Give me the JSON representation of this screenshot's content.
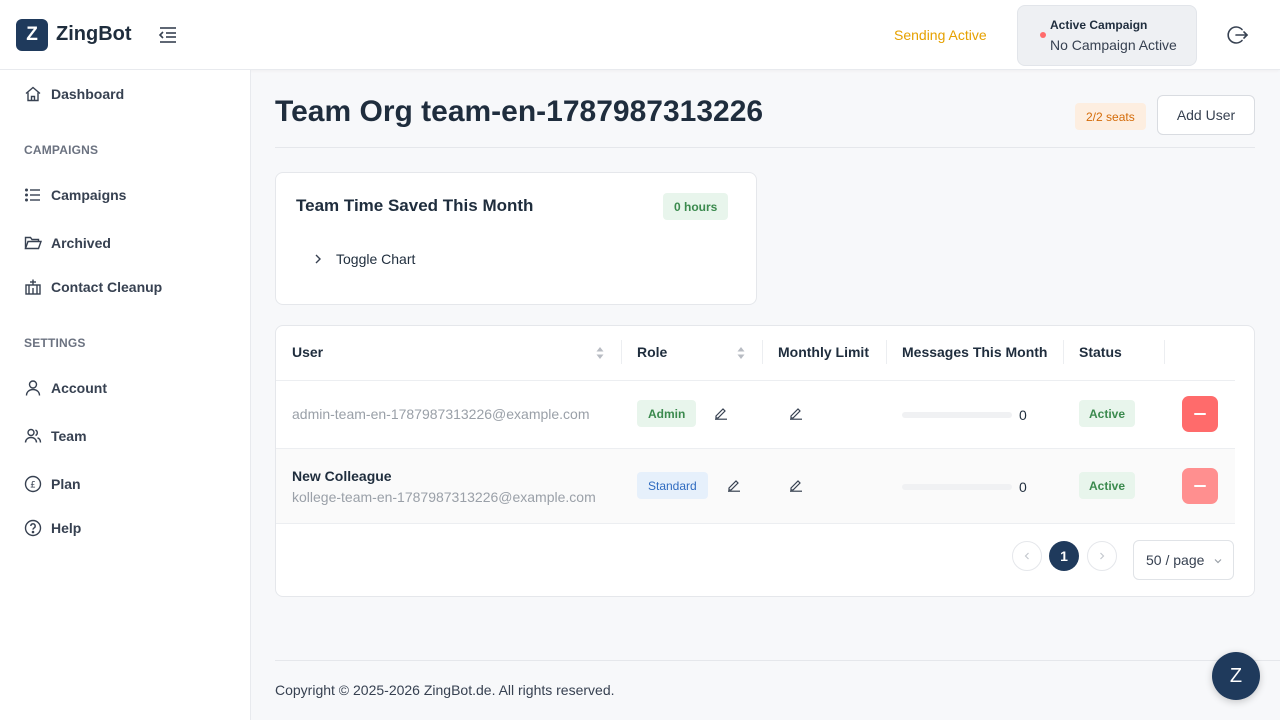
{
  "app": {
    "logo_letter": "Z",
    "name": "ZingBot"
  },
  "header": {
    "sending_status": "Sending Active",
    "campaign_title": "Active Campaign",
    "campaign_value": "No Campaign Active"
  },
  "sidebar": {
    "dashboard": "Dashboard",
    "campaigns_section": "CAMPAIGNS",
    "campaigns": "Campaigns",
    "archived": "Archived",
    "contact_cleanup": "Contact Cleanup",
    "settings_section": "SETTINGS",
    "account": "Account",
    "team": "Team",
    "plan": "Plan",
    "help": "Help"
  },
  "page": {
    "title": "Team Org team-en-1787987313226",
    "seats": "2/2 seats",
    "add_user": "Add User"
  },
  "time_card": {
    "title": "Team Time Saved This Month",
    "hours": "0 hours",
    "toggle": "Toggle Chart"
  },
  "table": {
    "columns": [
      "User",
      "Role",
      "Monthly Limit",
      "Messages This Month",
      "Status"
    ],
    "rows": [
      {
        "name": "",
        "email": "admin-team-en-1787987313226@example.com",
        "role": "Admin",
        "messages": "0",
        "progress": 0,
        "status": "Active"
      },
      {
        "name": "New Colleague",
        "email": "kollege-team-en-1787987313226@example.com",
        "role": "Standard",
        "messages": "0",
        "progress": 0,
        "status": "Active"
      }
    ]
  },
  "pagination": {
    "current_page": "1",
    "page_size": "50 / page"
  },
  "footer": {
    "copyright": "Copyright © 2025-2026 ZingBot.de. All rights reserved."
  },
  "chat": {
    "letter": "Z"
  },
  "colors": {
    "brand": "#1f3a5c",
    "warning": "#e6a100",
    "danger": "#ff6b6b",
    "success": "#3b8a4e"
  }
}
